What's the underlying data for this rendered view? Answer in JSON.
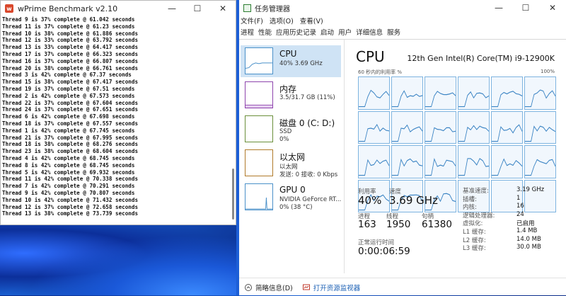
{
  "wprime": {
    "title": "wPrime Benchmark v2.10",
    "controls": {
      "min": "—",
      "max": "☐",
      "close": "✕"
    },
    "lines": [
      "Thread 9 is 37% complete @ 61.042 seconds",
      "Thread 11 is 37% complete @ 61.23 seconds",
      "Thread 10 is 38% complete @ 61.886 seconds",
      "Thread 12 is 33% complete @ 63.792 seconds",
      "Thread 13 is 33% complete @ 64.417 seconds",
      "Thread 17 is 37% complete @ 66.323 seconds",
      "Thread 16 is 37% complete @ 66.807 seconds",
      "Thread 20 is 38% complete @ 66.761 seconds",
      "Thread 3 is 42% complete @ 67.37 seconds",
      "Thread 15 is 38% complete @ 67.417 seconds",
      "Thread 19 is 37% complete @ 67.51 seconds",
      "Thread 2 is 42% complete @ 67.573 seconds",
      "Thread 22 is 37% complete @ 67.604 seconds",
      "Thread 24 is 37% complete @ 67.651 seconds",
      "Thread 6 is 42% complete @ 67.698 seconds",
      "Thread 18 is 37% complete @ 67.557 seconds",
      "Thread 1 is 42% complete @ 67.745 seconds",
      "Thread 21 is 37% complete @ 67.995 seconds",
      "Thread 18 is 38% complete @ 68.276 seconds",
      "Thread 23 is 38% complete @ 68.604 seconds",
      "Thread 4 is 42% complete @ 68.745 seconds",
      "Thread 8 is 42% complete @ 68.745 seconds",
      "Thread 5 is 42% complete @ 69.932 seconds",
      "Thread 11 is 42% complete @ 70.338 seconds",
      "Thread 7 is 42% complete @ 70.291 seconds",
      "Thread 9 is 42% complete @ 70.807 seconds",
      "Thread 10 is 42% complete @ 71.432 seconds",
      "Thread 12 is 37% complete @ 72.658 seconds",
      "Thread 13 is 38% complete @ 73.739 seconds"
    ]
  },
  "taskmgr": {
    "title": "任务管理器",
    "controls": {
      "min": "—",
      "max": "☐",
      "close": "✕"
    },
    "menu": [
      "文件(F)",
      "选项(O)",
      "查看(V)"
    ],
    "tabs": [
      "进程",
      "性能",
      "应用历史记录",
      "启动",
      "用户",
      "详细信息",
      "服务"
    ],
    "resources": [
      {
        "name": "CPU",
        "s1": "40%  3.69 GHz",
        "s2": "",
        "color": "#4a90c9"
      },
      {
        "name": "内存",
        "s1": "3.5/31.7 GB (11%)",
        "s2": "",
        "color": "#8e44ad"
      },
      {
        "name": "磁盘 0 (C: D:)",
        "s1": "SSD",
        "s2": "0%",
        "color": "#6a8f3a"
      },
      {
        "name": "以太网",
        "s1": "以太网",
        "s2": "发送: 0 接收: 0 Kbps",
        "color": "#b07a2a"
      },
      {
        "name": "GPU 0",
        "s1": "NVIDIA GeForce RT...",
        "s2": "0% (38 °C)",
        "color": "#4a90c9"
      }
    ],
    "cpu": {
      "heading": "CPU",
      "model": "12th Gen Intel(R) Core(TM) i9-12900K",
      "axis_left": "60 秒内的利用率 %",
      "axis_right": "100%",
      "util_label": "利用率",
      "util_value": "40%",
      "speed_label": "速度",
      "speed_value": "3.69 GHz",
      "proc_label": "进程",
      "proc_value": "163",
      "thread_label": "线程",
      "thread_value": "1950",
      "handle_label": "句柄",
      "handle_value": "61380",
      "uptime_label": "正常运行时间",
      "uptime_value": "0:00:06:59",
      "specs": [
        {
          "k": "基准速度:",
          "v": "3.19 GHz"
        },
        {
          "k": "插槽:",
          "v": "1"
        },
        {
          "k": "内核:",
          "v": "16"
        },
        {
          "k": "逻辑处理器:",
          "v": "24"
        },
        {
          "k": "虚拟化:",
          "v": "已启用"
        },
        {
          "k": "L1 缓存:",
          "v": "1.4 MB"
        },
        {
          "k": "L2 缓存:",
          "v": "14.0 MB"
        },
        {
          "k": "L3 缓存:",
          "v": "30.0 MB"
        }
      ],
      "cores_total": 24,
      "cores_active": 21
    },
    "footer": {
      "summary": "简略信息(D)",
      "monitor": "打开资源监视器"
    }
  }
}
